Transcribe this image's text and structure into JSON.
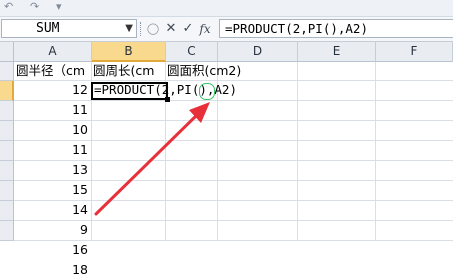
{
  "quick_access": {
    "undo_glyph": "↶",
    "redo_glyph": "↷",
    "dropdown_glyph": "▾"
  },
  "formula_bar": {
    "name_box": "SUM",
    "cancel_glyph": "✕",
    "enter_glyph": "✓",
    "fx_label": "fx",
    "formula": "=PRODUCT(2,PI(),A2)"
  },
  "grid": {
    "columns": [
      "A",
      "B",
      "C",
      "D",
      "E",
      "F"
    ],
    "selected_column": "B",
    "header_row": [
      "圆半径（cm",
      "圆周长(cm",
      "圆面积(cm2)"
    ],
    "editing_formula": "=PRODUCT(2,PI(),A2)",
    "radius_values": [
      "12",
      "11",
      "10",
      "11",
      "13",
      "15",
      "14",
      "9",
      "16",
      "18"
    ]
  },
  "colors": {
    "arrow": "#e8303a",
    "header_bg": "#e9edf2",
    "selected_header_bg": "#f8d98e",
    "paren_highlight": "#36c66a"
  },
  "icons": [
    "undo-icon",
    "redo-icon",
    "cancel-icon",
    "enter-icon",
    "insert-function-icon",
    "red-arrow"
  ]
}
